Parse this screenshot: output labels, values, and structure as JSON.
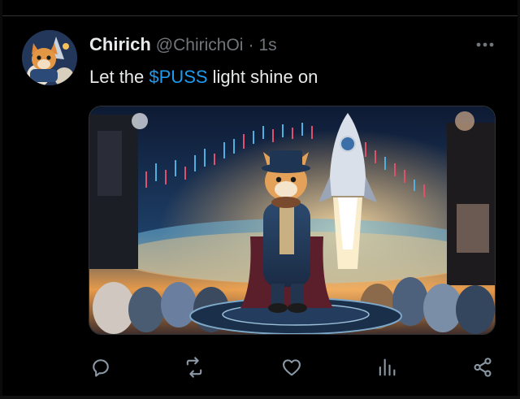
{
  "tweet": {
    "author_name": "Chirich",
    "handle": "@ChirichOi",
    "separator": "·",
    "time": "1s",
    "text_prefix": "Let the ",
    "cashtag": "$PUSS",
    "text_suffix": " light shine on"
  },
  "media": {
    "description_icon": "image",
    "subject": "cat-in-top-hat-with-rocket"
  },
  "actions": [
    {
      "name": "reply",
      "icon": "speech-bubble-icon"
    },
    {
      "name": "repost",
      "icon": "repost-arrows-icon"
    },
    {
      "name": "like",
      "icon": "heart-icon"
    },
    {
      "name": "views",
      "icon": "bar-chart-icon"
    },
    {
      "name": "share",
      "icon": "share-nodes-icon"
    }
  ],
  "colors": {
    "background": "#000000",
    "text": "#e7e9ea",
    "muted": "#71767b",
    "link": "#1d9bf0"
  }
}
